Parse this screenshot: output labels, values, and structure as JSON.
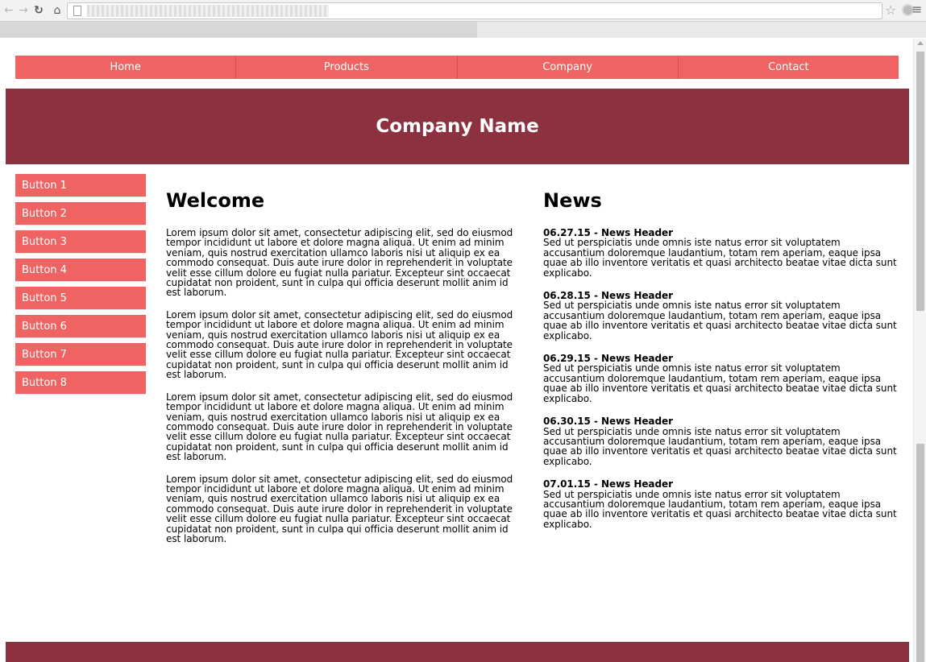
{
  "browser": {
    "back_icon": "back-arrow-icon",
    "forward_icon": "forward-arrow-icon",
    "reload_icon": "reload-icon",
    "home_icon": "home-icon",
    "url": "",
    "bookmark_icon": "star-icon",
    "menu_icon": "hamburger-menu-icon"
  },
  "nav": {
    "items": [
      "Home",
      "Products",
      "Company",
      "Contact"
    ]
  },
  "header": {
    "company_name": "Company Name"
  },
  "sidebar": {
    "buttons": [
      "Button 1",
      "Button 2",
      "Button 3",
      "Button 4",
      "Button 5",
      "Button 6",
      "Button 7",
      "Button 8"
    ]
  },
  "welcome": {
    "title": "Welcome",
    "paragraphs": [
      "Lorem ipsum dolor sit amet, consectetur adipiscing elit, sed do eiusmod tempor incididunt ut labore et dolore magna aliqua. Ut enim ad minim veniam, quis nostrud exercitation ullamco laboris nisi ut aliquip ex ea commodo consequat. Duis aute irure dolor in reprehenderit in voluptate velit esse cillum dolore eu fugiat nulla pariatur. Excepteur sint occaecat cupidatat non proident, sunt in culpa qui officia deserunt mollit anim id est laborum.",
      "Lorem ipsum dolor sit amet, consectetur adipiscing elit, sed do eiusmod tempor incididunt ut labore et dolore magna aliqua. Ut enim ad minim veniam, quis nostrud exercitation ullamco laboris nisi ut aliquip ex ea commodo consequat. Duis aute irure dolor in reprehenderit in voluptate velit esse cillum dolore eu fugiat nulla pariatur. Excepteur sint occaecat cupidatat non proident, sunt in culpa qui officia deserunt mollit anim id est laborum.",
      "Lorem ipsum dolor sit amet, consectetur adipiscing elit, sed do eiusmod tempor incididunt ut labore et dolore magna aliqua. Ut enim ad minim veniam, quis nostrud exercitation ullamco laboris nisi ut aliquip ex ea commodo consequat. Duis aute irure dolor in reprehenderit in voluptate velit esse cillum dolore eu fugiat nulla pariatur. Excepteur sint occaecat cupidatat non proident, sunt in culpa qui officia deserunt mollit anim id est laborum.",
      "Lorem ipsum dolor sit amet, consectetur adipiscing elit, sed do eiusmod tempor incididunt ut labore et dolore magna aliqua. Ut enim ad minim veniam, quis nostrud exercitation ullamco laboris nisi ut aliquip ex ea commodo consequat. Duis aute irure dolor in reprehenderit in voluptate velit esse cillum dolore eu fugiat nulla pariatur. Excepteur sint occaecat cupidatat non proident, sunt in culpa qui officia deserunt mollit anim id est laborum."
    ]
  },
  "news": {
    "title": "News",
    "items": [
      {
        "date": "06.27.15",
        "header": "News Header",
        "body": "Sed ut perspiciatis unde omnis iste natus error sit voluptatem accusantium doloremque laudantium, totam rem aperiam, eaque ipsa quae ab illo inventore veritatis et quasi architecto beatae vitae dicta sunt explicabo."
      },
      {
        "date": "06.28.15",
        "header": "News Header",
        "body": "Sed ut perspiciatis unde omnis iste natus error sit voluptatem accusantium doloremque laudantium, totam rem aperiam, eaque ipsa quae ab illo inventore veritatis et quasi architecto beatae vitae dicta sunt explicabo."
      },
      {
        "date": "06.29.15",
        "header": "News Header",
        "body": "Sed ut perspiciatis unde omnis iste natus error sit voluptatem accusantium doloremque laudantium, totam rem aperiam, eaque ipsa quae ab illo inventore veritatis et quasi architecto beatae vitae dicta sunt explicabo."
      },
      {
        "date": "06.30.15",
        "header": "News Header",
        "body": "Sed ut perspiciatis unde omnis iste natus error sit voluptatem accusantium doloremque laudantium, totam rem aperiam, eaque ipsa quae ab illo inventore veritatis et quasi architecto beatae vitae dicta sunt explicabo."
      },
      {
        "date": "07.01.15",
        "header": "News Header",
        "body": "Sed ut perspiciatis unde omnis iste natus error sit voluptatem accusantium doloremque laudantium, totam rem aperiam, eaque ipsa quae ab illo inventore veritatis et quasi architecto beatae vitae dicta sunt explicabo."
      }
    ]
  },
  "colors": {
    "accent": "#f06363",
    "banner": "#8c3140",
    "footer": "#8c3140"
  }
}
